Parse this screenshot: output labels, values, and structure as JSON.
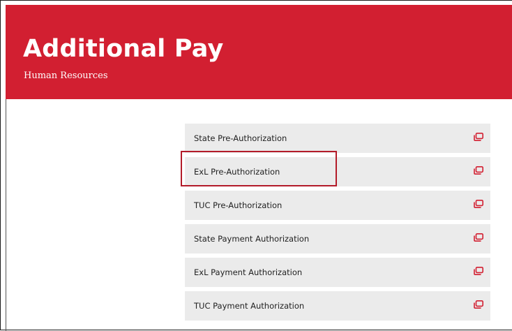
{
  "header": {
    "title": "Additional Pay",
    "subtitle": "Human Resources"
  },
  "links": [
    {
      "label": "State Pre-Authorization",
      "icon": "external-window-icon"
    },
    {
      "label": "ExL Pre-Authorization",
      "icon": "external-window-icon",
      "highlighted": true
    },
    {
      "label": "TUC Pre-Authorization",
      "icon": "external-window-icon"
    },
    {
      "label": "State Payment Authorization",
      "icon": "external-window-icon"
    },
    {
      "label": "ExL Payment Authorization",
      "icon": "external-window-icon"
    },
    {
      "label": "TUC Payment Authorization",
      "icon": "external-window-icon"
    }
  ],
  "colors": {
    "brand_red": "#d21f31",
    "link_background": "#ebebeb",
    "highlight_border": "#b31b29"
  }
}
